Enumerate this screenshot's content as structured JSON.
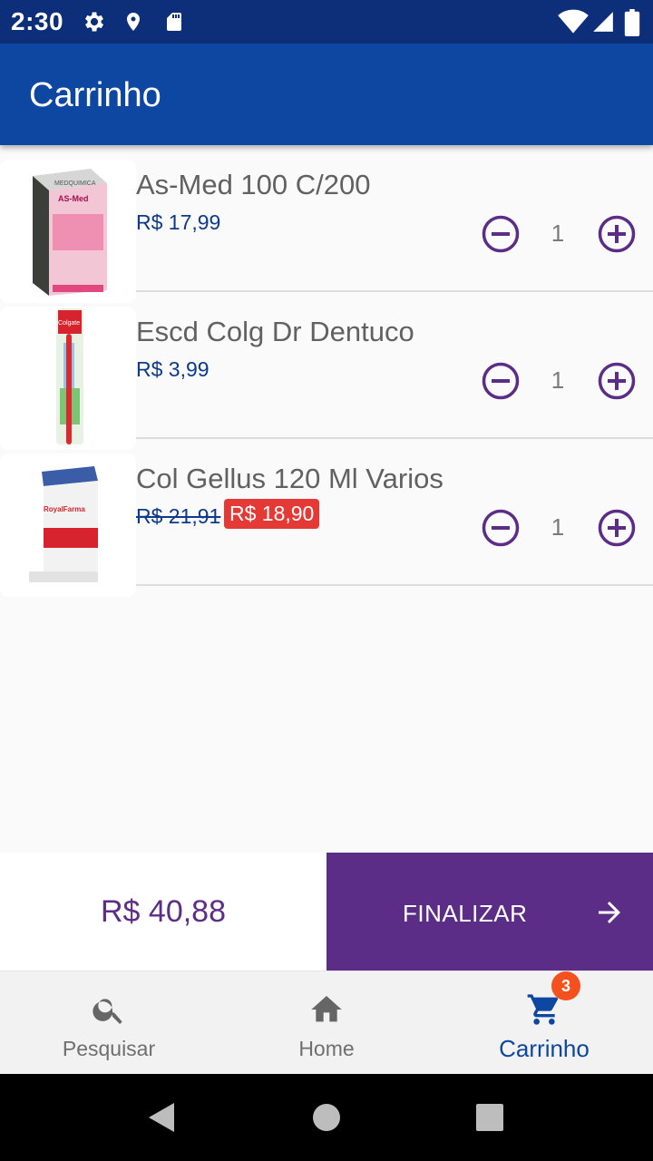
{
  "status_bar": {
    "time": "2:30",
    "icons": [
      "settings-gear-icon",
      "location-pin-icon",
      "sd-card-icon",
      "wifi-icon",
      "cell-signal-icon",
      "battery-icon"
    ]
  },
  "app_bar": {
    "title": "Carrinho",
    "color": "#0d47a1"
  },
  "cart": {
    "items": [
      {
        "name": "As-Med  100 C/200",
        "price": "R$ 17,99",
        "quantity": "1"
      },
      {
        "name": "Escd Colg Dr Dentuco",
        "price": "R$ 3,99",
        "quantity": "1"
      },
      {
        "name": "Col Gellus 120 Ml Varios",
        "old_price": "R$ 21,91",
        "sale_price": "R$ 18,90",
        "quantity": "1"
      }
    ],
    "product_image_text": [
      "MEDQUIMICA",
      "AS-Med",
      "Colgate",
      "RoyalFarma"
    ]
  },
  "checkout": {
    "total": "R$ 40,88",
    "finalize_label": "FINALIZAR",
    "accent_color": "#5c2d86"
  },
  "bottom_nav": {
    "items": [
      {
        "label": "Pesquisar",
        "icon": "search-icon"
      },
      {
        "label": "Home",
        "icon": "home-icon"
      },
      {
        "label": "Carrinho",
        "icon": "cart-icon",
        "badge": "3",
        "active": true
      }
    ]
  },
  "system_nav": {
    "icons": [
      "back-icon",
      "home-circle-icon",
      "recents-icon"
    ]
  }
}
